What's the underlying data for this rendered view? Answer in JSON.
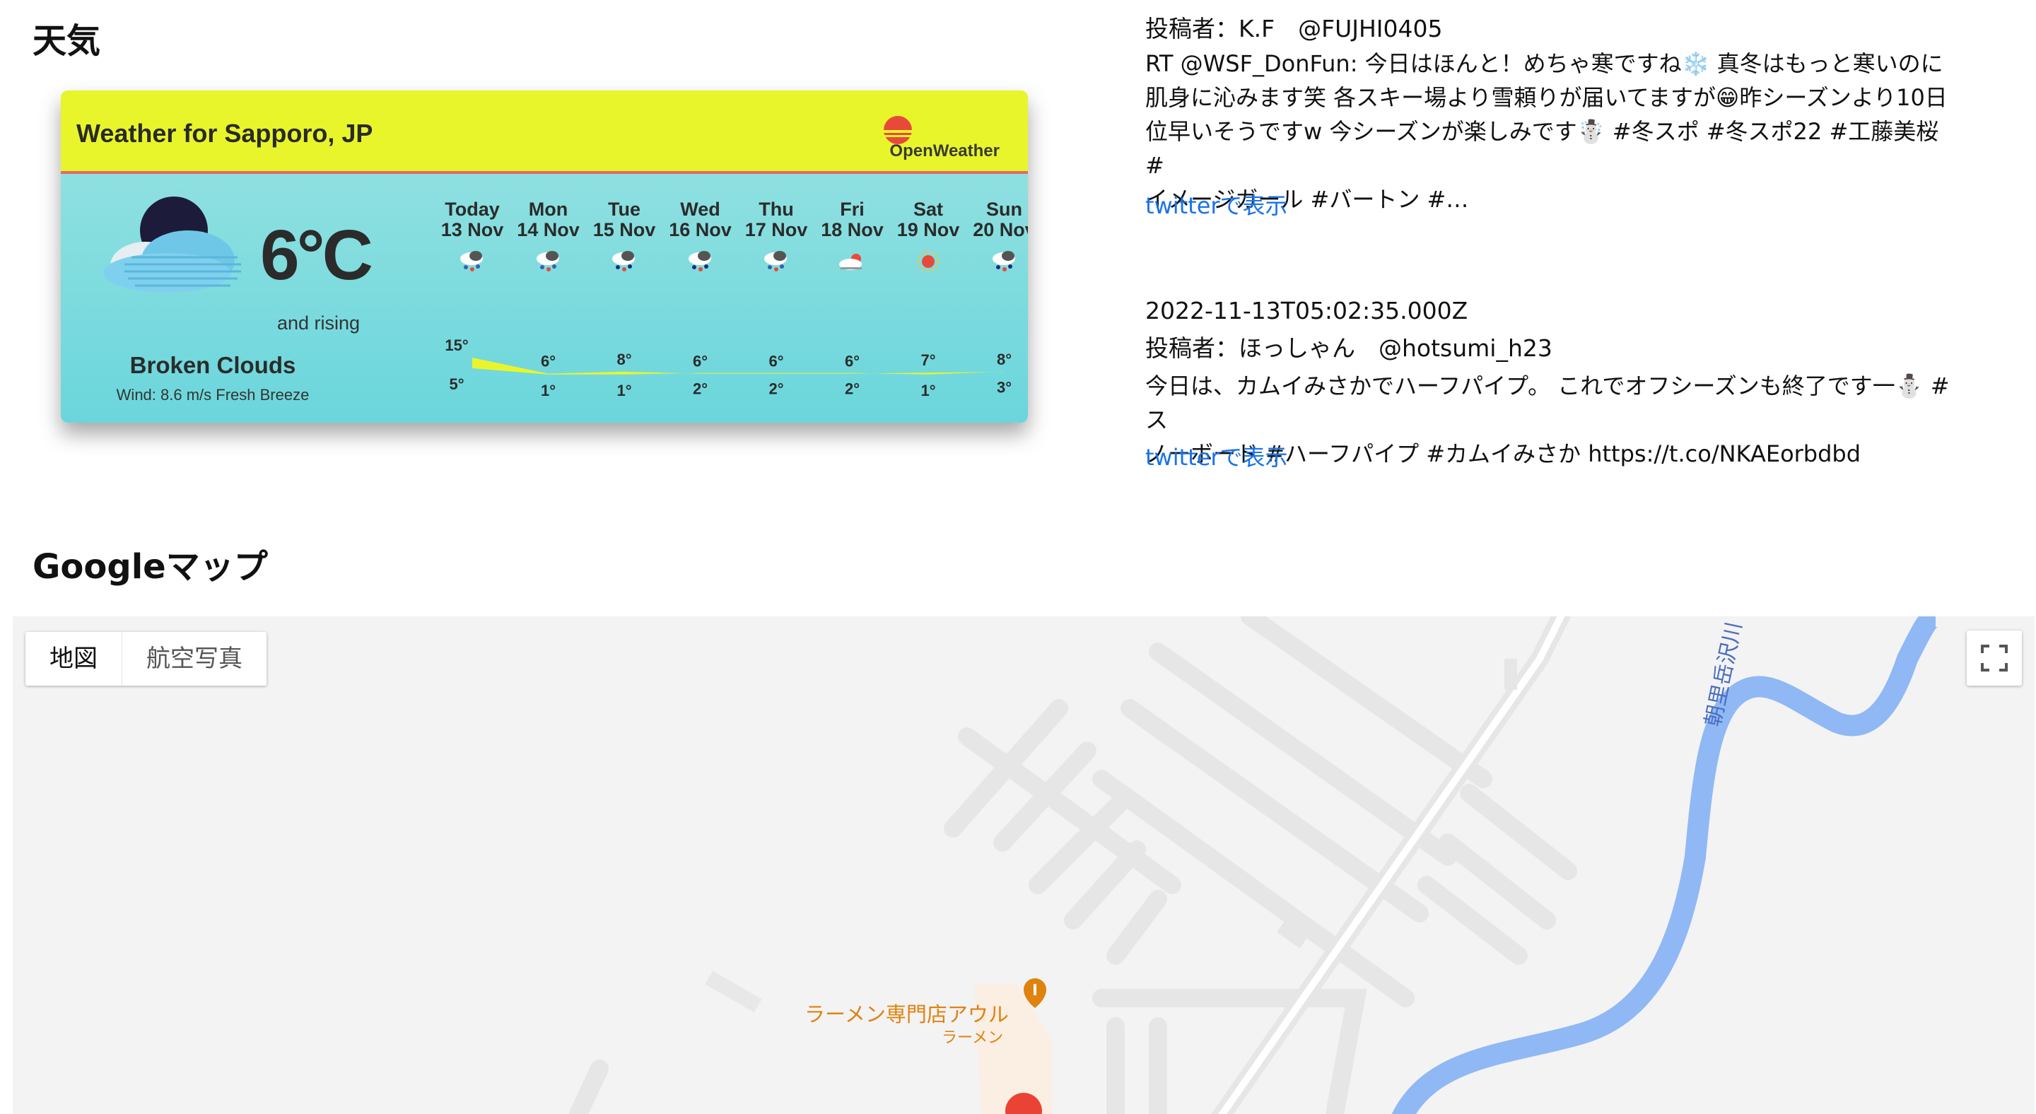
{
  "sections": {
    "weather_title": "天気",
    "maps_title": "Googleマップ"
  },
  "weather": {
    "header_title": "Weather for Sapporo, JP",
    "brand": "OpenWeather",
    "current_temp": "6°C",
    "trend": "and rising",
    "condition": "Broken Clouds",
    "wind": "Wind: 8.6 m/s Fresh Breeze",
    "days": [
      {
        "name": "Today",
        "date": "13 Nov",
        "icon": "snow-cloud-icon",
        "high": "15°",
        "low": "5°"
      },
      {
        "name": "Mon",
        "date": "14 Nov",
        "icon": "snow-cloud-icon",
        "high": "6°",
        "low": "1°"
      },
      {
        "name": "Tue",
        "date": "15 Nov",
        "icon": "rain-cloud-icon",
        "high": "8°",
        "low": "1°"
      },
      {
        "name": "Wed",
        "date": "16 Nov",
        "icon": "rain-cloud-icon",
        "high": "6°",
        "low": "2°"
      },
      {
        "name": "Thu",
        "date": "17 Nov",
        "icon": "snow-cloud-icon",
        "high": "6°",
        "low": "2°"
      },
      {
        "name": "Fri",
        "date": "18 Nov",
        "icon": "cloudy-sun-icon",
        "high": "6°",
        "low": "2°"
      },
      {
        "name": "Sat",
        "date": "19 Nov",
        "icon": "sun-icon",
        "high": "7°",
        "low": "1°"
      },
      {
        "name": "Sun",
        "date": "20 Nov",
        "icon": "rain-cloud-icon",
        "high": "8°",
        "low": "3°"
      }
    ],
    "colors": {
      "header": "#e8f52b",
      "body": "#7adcdf",
      "band": "#e9f52c"
    }
  },
  "tweets": [
    {
      "user": "投稿者：K.F　@FUJHI0405",
      "lines": [
        "RT @WSF_DonFun: 今日はほんと！めちゃ寒ですね❄️ 真冬はもっと寒いのに",
        "肌身に沁みます笑 各スキー場より雪頼りが届いてますが😁昨シーズンより10日",
        "位早いそうですw 今シーズンが楽しみです☃️ #冬スポ #冬スポ22 #工藤美桜 #",
        "イメージガール #バートン #…"
      ],
      "link": "twitterで表示"
    },
    {
      "date": "2022-11-13T05:02:35.000Z",
      "user": "投稿者：ほっしゃん　@hotsumi_h23",
      "lines": [
        "今日は、カムイみさかでハーフパイプ。 これでオフシーズンも終了です一⛄️ #ス",
        "ノーボード #ハーフパイプ #カムイみさか https://t.co/NKAEorbdbd"
      ],
      "link": "twitterで表示"
    }
  ],
  "map": {
    "map_button": "地図",
    "satellite_button": "航空写真",
    "poi_name": "ラーメン専門店アウル",
    "poi_category": "ラーメン",
    "river_name": "朝里岳沢川",
    "colors": {
      "river": "#8fb8f5",
      "poi": "#e0820e",
      "marker": "#ea4335"
    }
  }
}
